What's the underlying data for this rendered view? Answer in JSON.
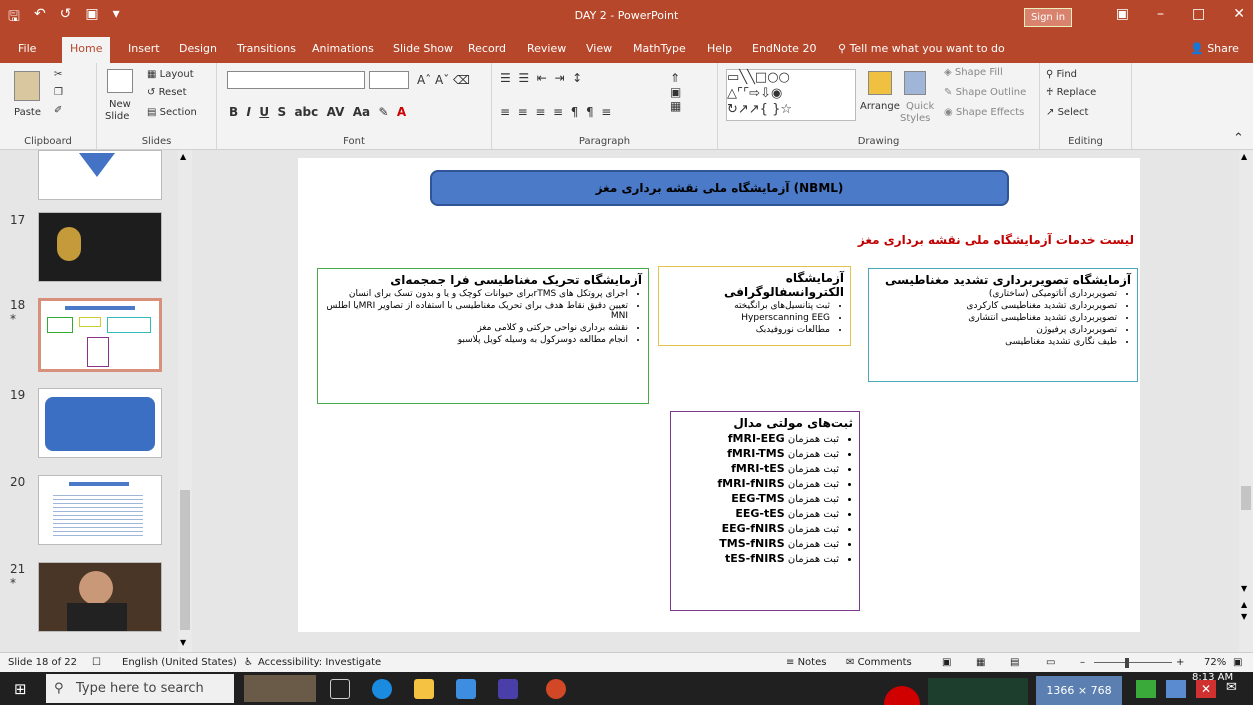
{
  "titlebar": {
    "title": "DAY 2 - PowerPoint",
    "signin": "Sign in"
  },
  "tabs": [
    "File",
    "Home",
    "Insert",
    "Design",
    "Transitions",
    "Animations",
    "Slide Show",
    "Record",
    "Review",
    "View",
    "MathType",
    "Help",
    "EndNote 20"
  ],
  "tell_me": "Tell me what you want to do",
  "share": "Share",
  "ribbon": {
    "clipboard": {
      "label": "Clipboard",
      "paste": "Paste"
    },
    "slides": {
      "label": "Slides",
      "new_slide": "New",
      "new_slide2": "Slide",
      "layout": "Layout",
      "reset": "Reset",
      "section": "Section"
    },
    "font": {
      "label": "Font"
    },
    "paragraph": {
      "label": "Paragraph"
    },
    "drawing": {
      "label": "Drawing",
      "arrange": "Arrange",
      "quick_styles": "Quick",
      "quick_styles2": "Styles",
      "shape_fill": "Shape Fill",
      "shape_outline": "Shape Outline",
      "shape_effects": "Shape Effects"
    },
    "editing": {
      "label": "Editing",
      "find": "Find",
      "replace": "Replace",
      "select": "Select"
    }
  },
  "thumbnails": [
    {
      "num": "17",
      "star": ""
    },
    {
      "num": "18",
      "star": "*"
    },
    {
      "num": "19",
      "star": ""
    },
    {
      "num": "20",
      "star": ""
    },
    {
      "num": "21",
      "star": "*"
    }
  ],
  "slide": {
    "title": "آزمایشگاه ملی نقشه برداری مغز (NBML)",
    "red_title": "لیست خدمات آزمایشگاه ملی نقشه برداری مغز",
    "box_mri": {
      "heading": "آزمایشگاه تصویربرداری تشدید مغناطیسی",
      "items": [
        "تصویربرداری آناتومیکی (ساختاری)",
        "تصویربرداری تشدید مغناطیسی کارکردی",
        "تصویربرداری تشدید مغناطیسی انتشاری",
        "تصویربرداری پرفیوژن",
        "طیف نگاری تشدید مغناطیسی"
      ]
    },
    "box_eeg": {
      "heading": "آزمایشگاه الکتروانسفالوگرافی",
      "items": [
        "ثبت پتانسیل‌های برانگیخته",
        "Hyperscanning EEG",
        "مطالعات نوروفیدبک"
      ]
    },
    "box_tms": {
      "heading": "آزمایشگاه تحریک مغناطیسی فرا جمجمه‌ای",
      "items": [
        "اجرای پروتکل های rTMSبرای حیوانات کوچک و یا و بدون تسک برای انسان",
        "تعیین دقیق نقاط هدف برای تحریک مغناطیسی با استفاده از تصاویر MRIیا اطلس MNI",
        "نقشه برداری نواحی حرکتی و کلامی مغز",
        "انجام مطالعه دوسرکول به وسیله کویل پلاسبو"
      ]
    },
    "box_multi": {
      "heading": "ثبت‌های مولتی مدال",
      "prefix": "ثبت همزمان",
      "items": [
        "fMRI-EEG",
        "fMRI-TMS",
        "fMRI-tES",
        "fMRI-fNIRS",
        "EEG-TMS",
        "EEG-tES",
        "EEG-fNIRS",
        "TMS-fNIRS",
        "tES-fNIRS"
      ]
    }
  },
  "status": {
    "slide": "Slide 18 of 22",
    "language": "English (United States)",
    "accessibility": "Accessibility: Investigate",
    "notes": "Notes",
    "comments": "Comments",
    "zoom": "72%"
  },
  "taskbar": {
    "search": "Type here to search",
    "resolution": "1366 × 768",
    "time": "8:13 AM"
  }
}
